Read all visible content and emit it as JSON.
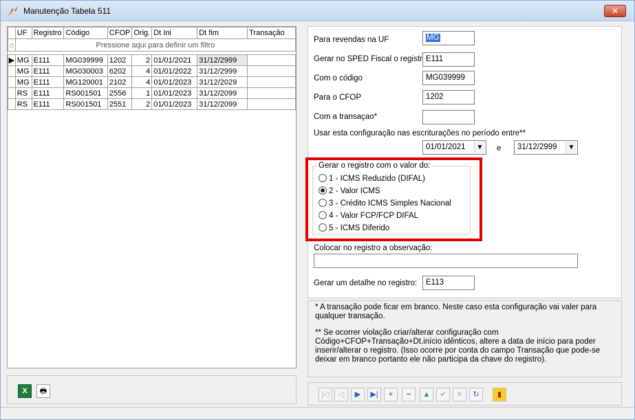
{
  "window": {
    "title": "Manutenção Tabela 511",
    "close_glyph": "✕"
  },
  "grid": {
    "columns": [
      "UF",
      "Registro",
      "Código",
      "CFOP",
      "Orig.",
      "Dt Ini",
      "Dt fim",
      "Transação"
    ],
    "filter_hint": "Pressione aqui para definir um filtro",
    "rows": [
      [
        "MG",
        "E111",
        "MG039999",
        "1202",
        "2",
        "01/01/2021",
        "31/12/2999",
        ""
      ],
      [
        "MG",
        "E111",
        "MG030003",
        "6202",
        "4",
        "01/01/2022",
        "31/12/2999",
        ""
      ],
      [
        "MG",
        "E111",
        "MG120001",
        "2102",
        "4",
        "01/01/2023",
        "31/12/2029",
        ""
      ],
      [
        "RS",
        "E111",
        "RS001501",
        "2556",
        "1",
        "01/01/2023",
        "31/12/2099",
        ""
      ],
      [
        "RS",
        "E111",
        "RS001501",
        "2551",
        "2",
        "01/01/2023",
        "31/12/2099",
        ""
      ]
    ]
  },
  "left_tools": {
    "excel_glyph": "X",
    "print_glyph": "🖶"
  },
  "form": {
    "uf_label": "Para revendas na UF",
    "uf_value": "MG",
    "sped_label": "Gerar no SPED Fiscal o registro",
    "sped_value": "E111",
    "codigo_label": "Com o código",
    "codigo_value": "MG039999",
    "cfop_label": "Para o CFOP",
    "cfop_value": "1202",
    "transacao_label": "Com a transaçao*",
    "transacao_value": "",
    "periodo_label": "Usar esta configuração nas escriturações no período entre**",
    "data_ini": "01/01/2021",
    "periodo_e": "e",
    "data_fim": "31/12/2999",
    "group_title": "Gerar o registro com o valor do:",
    "options": [
      "1 - ICMS Reduzido (DIFAL)",
      "2 - Valor ICMS",
      "3 - Crédito ICMS Simples Nacional",
      "4 - Valor FCP/FCP DIFAL",
      "5 - ICMS Diferido"
    ],
    "selected_option": "2 - Valor ICMS",
    "obs_label": "Colocar no registro a observação:",
    "obs_value": "",
    "detalhe_label": "Gerar um detalhe no registro:",
    "detalhe_value": "E113"
  },
  "notes": {
    "note1": "* A transação pode ficar em branco. Neste caso esta configuração vai valer para qualquer transação.",
    "note2": "** Se ocorrer violação criar/alterar configuração com Código+CFOP+Transação+Dt.início idênticos, altere a data de início para poder inserir/alterar o registro. (Isso ocorre por conta do campo Transação que pode-se deixar em branco portanto ele não participa da chave do registro)."
  },
  "navigator": {
    "first": "|◁",
    "prior": "◁",
    "next": "▶",
    "last": "▶|",
    "insert": "+",
    "delete": "−",
    "edit": "▲",
    "post": "✔",
    "cancel": "✕",
    "refresh": "↻",
    "exit": "▮"
  },
  "colors": {
    "highlight_box": "#e00000",
    "title_gradient": "#c6d9f1",
    "selection": "#3370d4"
  }
}
